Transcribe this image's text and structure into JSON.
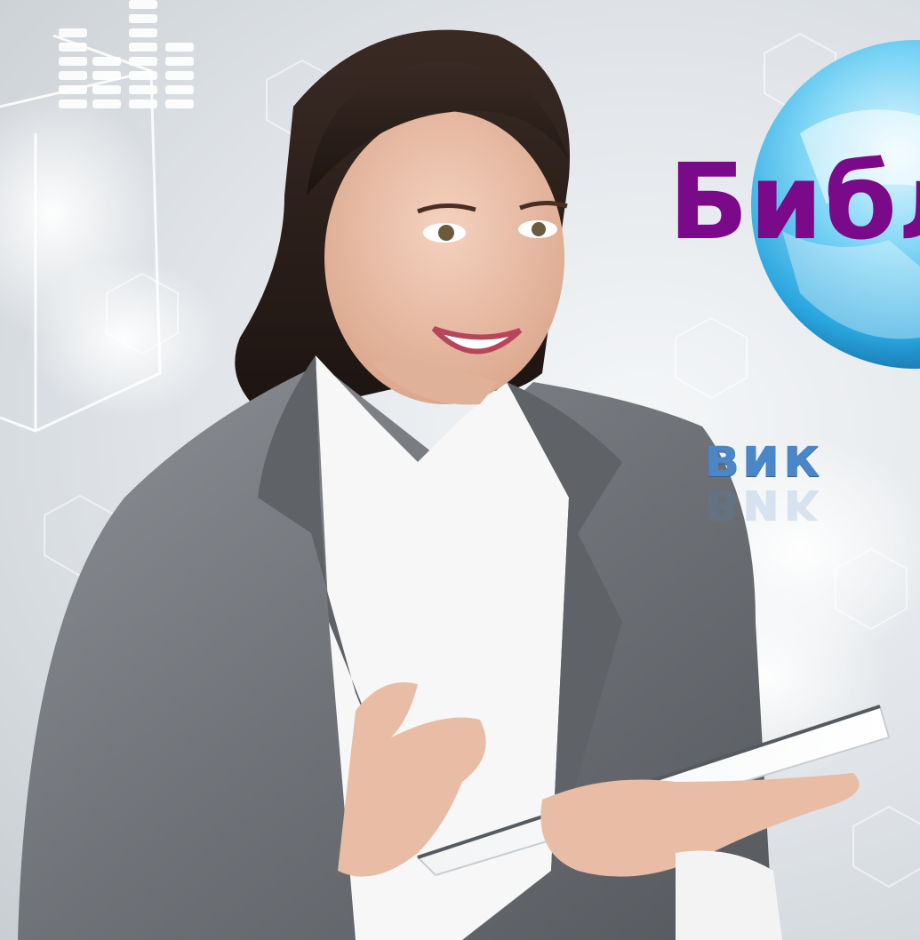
{
  "slide": {
    "title": "Библ",
    "subtitle": "вик",
    "colors": {
      "title": "#7a0a8a",
      "subtitle": "#4a86c8",
      "background": "#dfe3e7",
      "globe": "#35b8ec"
    }
  },
  "illustration": {
    "subject": "woman-holding-tablet",
    "decor": [
      "hexagon-grid",
      "globe",
      "glass-cube",
      "equalizer-bars",
      "clouds"
    ]
  }
}
